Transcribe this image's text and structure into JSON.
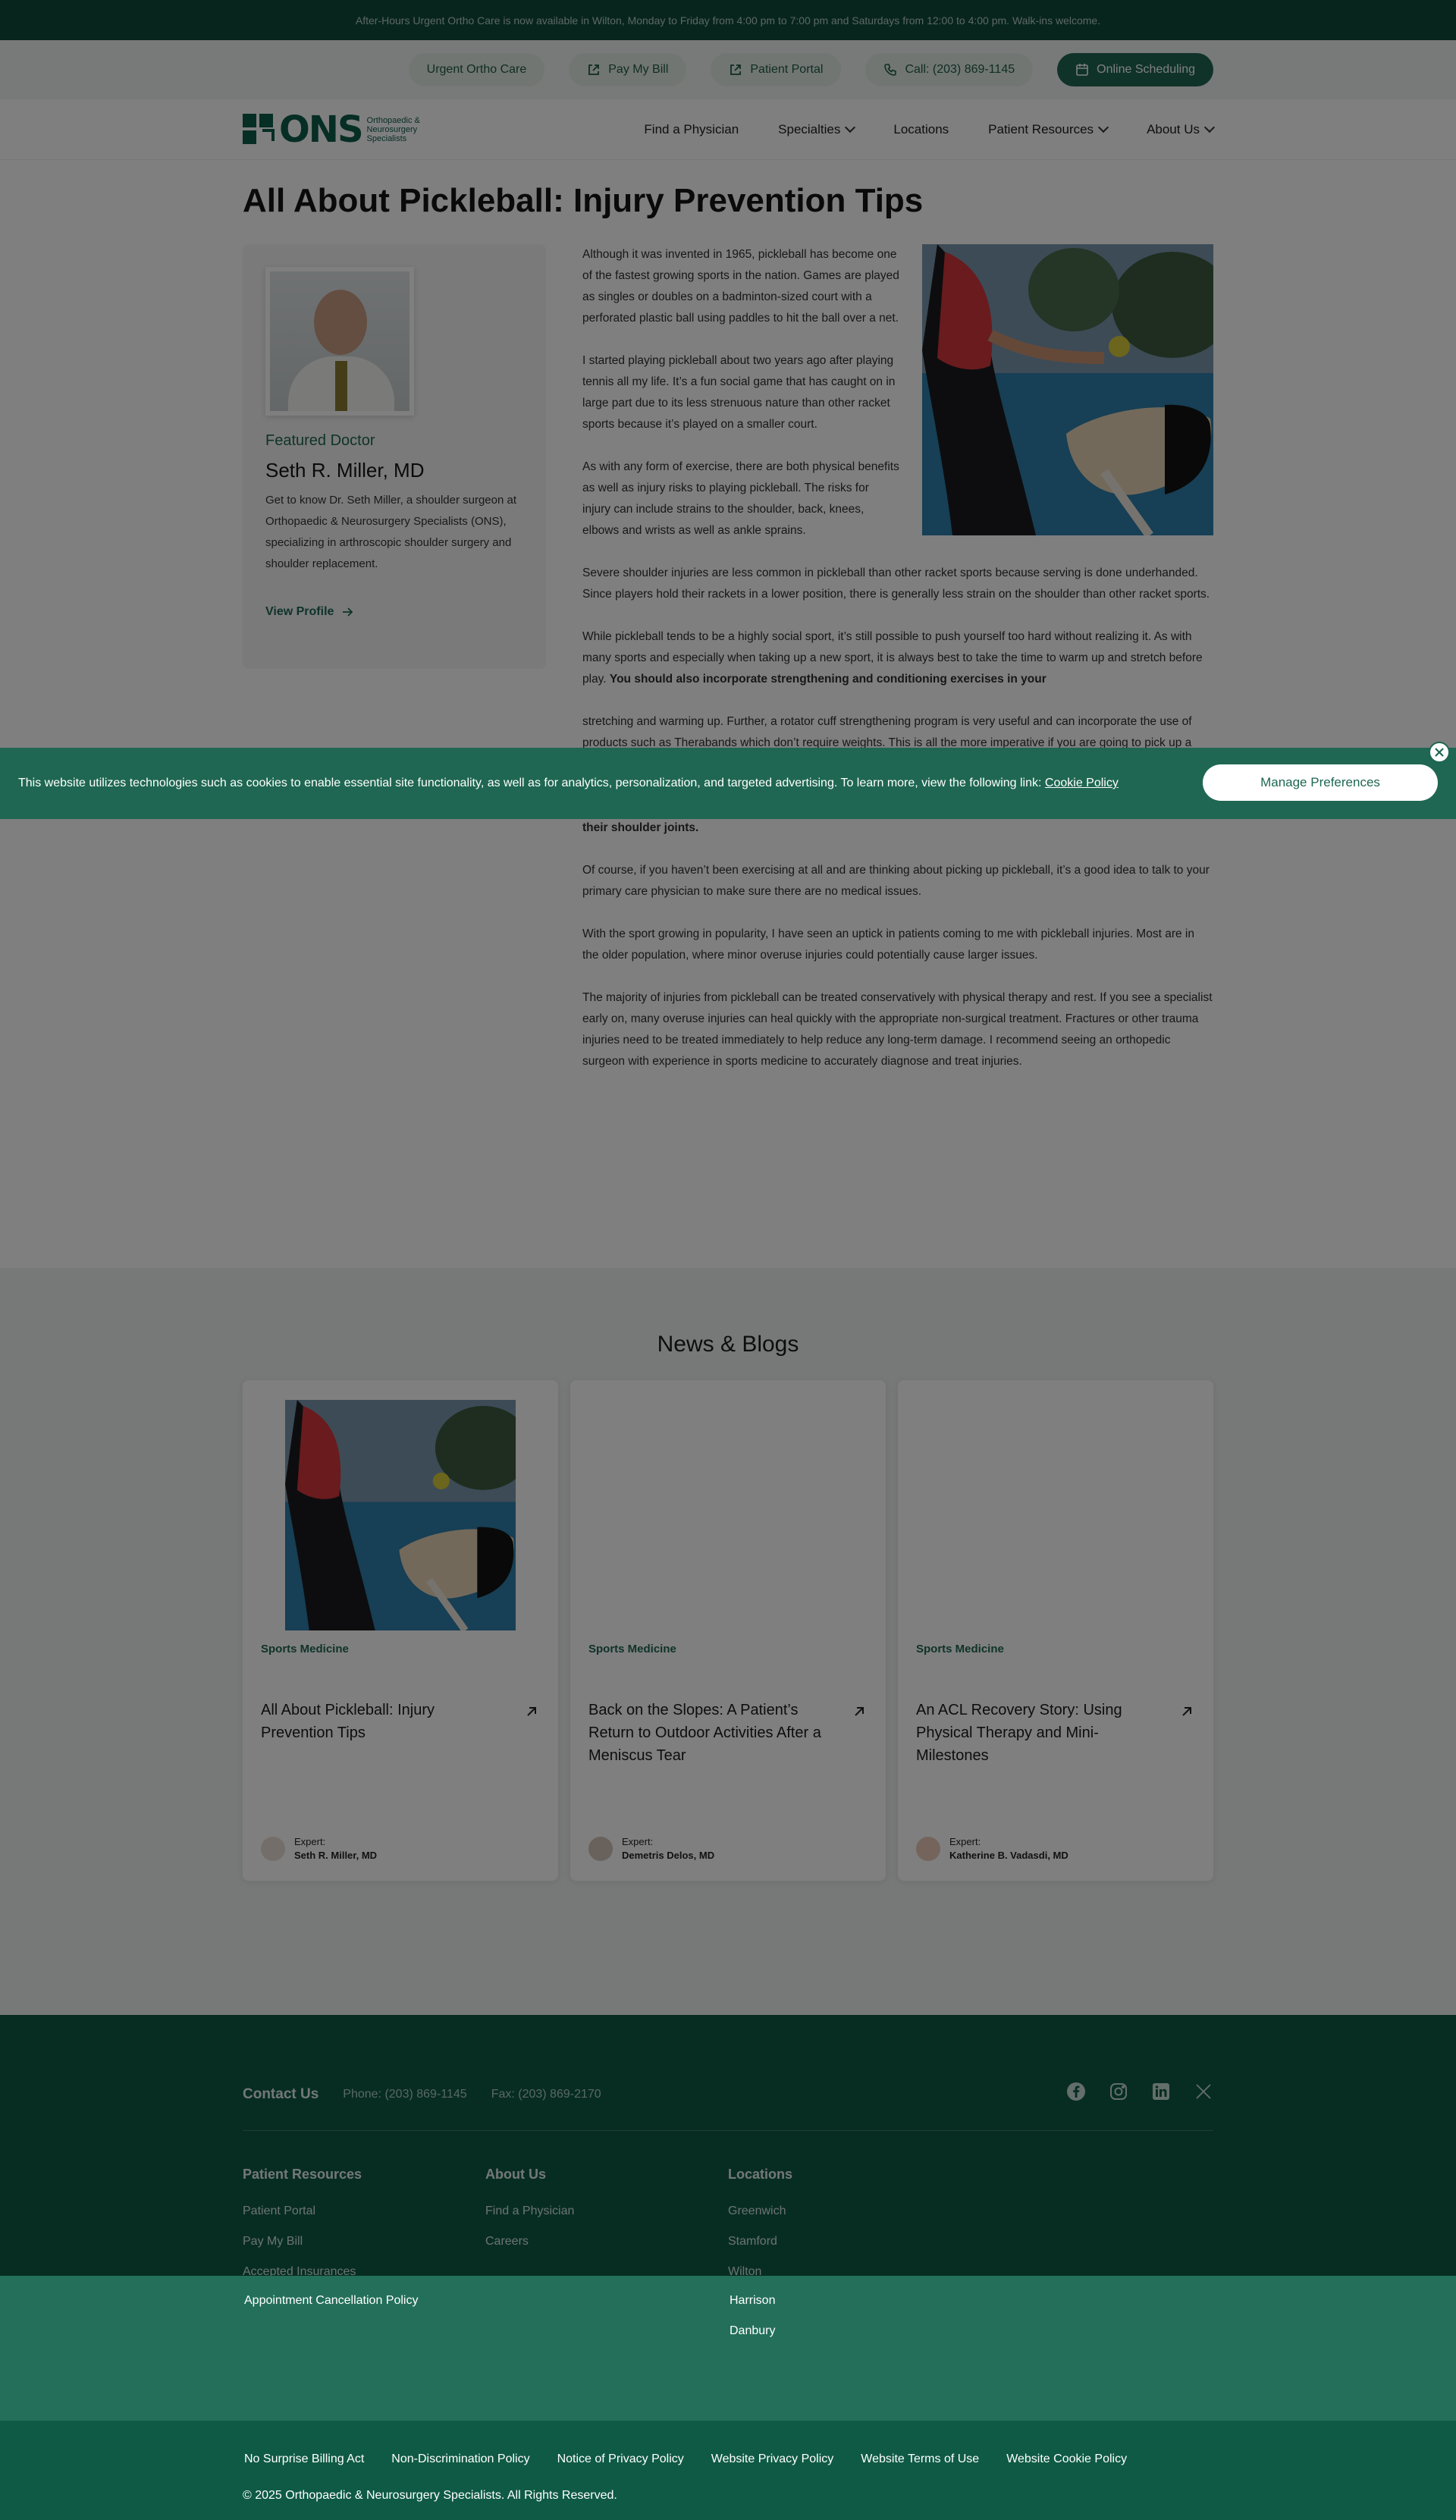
{
  "announcement": "After-Hours Urgent Ortho Care is now available in Wilton, Monday to Friday from 4:00 pm to 7:00 pm and Saturdays from 12:00 to 4:00 pm. Walk-ins welcome.",
  "utility": {
    "urgent": "Urgent Ortho Care",
    "pay": "Pay My Bill",
    "portal": "Patient Portal",
    "call": "Call: (203) 869-1145",
    "schedule": "Online Scheduling"
  },
  "logo": {
    "mark": "ONS",
    "sub": "Orthopaedic & Neurosurgery Specialists"
  },
  "nav": {
    "find": "Find a Physician",
    "specialties": "Specialties",
    "locations": "Locations",
    "resources": "Patient Resources",
    "about": "About Us"
  },
  "article": {
    "title": "All About Pickleball: Injury Prevention Tips",
    "p1": "Although it was invented in 1965, pickleball has become one of the fastest growing sports in the nation. Games are played as singles or doubles on a badminton-sized court with a perforated plastic ball using paddles to hit the ball over a net.",
    "p2": "I started playing pickleball about two years ago after playing tennis all my life. It’s a fun social game that has caught on in large part due to its less strenuous nature than other racket sports because it’s played on a smaller court.",
    "p3": "As with any form of exercise, there are both physical benefits as well as injury risks to playing pickleball. The risks for injury can include strains to the shoulder, back, knees, elbows and wrists as well as ankle sprains.",
    "p4": "Severe shoulder injuries are less common in pickleball than other racket sports because serving is done underhanded. Since players hold their rackets in a lower position, there is generally less strain on the shoulder than other racket sports.",
    "p5a": "While pickleball tends to be a highly social sport, it’s still possible to push yourself too hard without realizing it. As with many sports and especially when taking up a new sport, it is always best to take the time to warm up and stretch before play. ",
    "p5b": "You should also incorporate strengthening and conditioning exercises in your",
    "p5c": "stretching and warming up. Further, a rotator cuff strengthening program is very useful and can incorporate the use of products such as Therabands which don’t require weights. This is all the more imperative if you are going to pick up a new sport.",
    "p6": "Maintaining rotator cuff strength and overall shoulder flexibility is the best way someone can avoid injury to their shoulder joints.",
    "p7": "Of course, if you haven’t been exercising at all and are thinking about picking up pickleball, it’s a good idea to talk to your primary care physician to make sure there are no medical issues.",
    "p8": "With the sport growing in popularity, I have seen an uptick in patients coming to me with pickleball injuries. Most are in the older population, where minor overuse injuries could potentially cause larger issues.",
    "p9": "The majority of injuries from pickleball can be treated conservatively with physical therapy and rest. If you see a specialist early on, many overuse injuries can heal quickly with the appropriate non-surgical treatment. Fractures or other trauma injuries need to be treated immediately to help reduce any long-term damage. I recommend seeing an orthopedic surgeon with experience in sports medicine to accurately diagnose and treat injuries."
  },
  "doctor": {
    "featured": "Featured Doctor",
    "name": "Seth R. Miller, MD",
    "bio": "Get to know Dr. Seth Miller, a shoulder surgeon at Orthopaedic & Neurosurgery Specialists (ONS), specializing in arthroscopic shoulder surgery and shoulder replacement.",
    "view": "View Profile"
  },
  "cookie": {
    "message": "This website utilizes technologies such as cookies to enable essential site functionality, as well as for analytics, personalization, and targeted advertising. To learn more, view the following link: ",
    "link": "Cookie Policy",
    "button": "Manage Preferences"
  },
  "news": {
    "heading": "News & Blogs",
    "cards": [
      {
        "category": "Sports Medicine",
        "title": "All About Pickleball: Injury Prevention Tips",
        "expert_label": "Expert:",
        "expert": "Seth R. Miller, MD"
      },
      {
        "category": "Sports Medicine",
        "title": "Back on the Slopes: A Patient’s Return to Outdoor Activities After a Meniscus Tear",
        "expert_label": "Expert:",
        "expert": "Demetris Delos, MD"
      },
      {
        "category": "Sports Medicine",
        "title": "An ACL Recovery Story: Using Physical Therapy and Mini-Milestones",
        "expert_label": "Expert:",
        "expert": "Katherine B. Vadasdi, MD"
      }
    ]
  },
  "footer": {
    "contact_label": "Contact Us",
    "phone": "Phone: (203) 869-1145",
    "fax": "Fax: (203) 869-2170",
    "col1": {
      "heading": "Patient Resources",
      "links": [
        "Patient Portal",
        "Pay My Bill",
        "Accepted Insurances",
        "Appointment Cancellation Policy"
      ]
    },
    "col2": {
      "heading": "About Us",
      "links": [
        "Find a Physician",
        "Careers"
      ]
    },
    "col3": {
      "heading": "Locations",
      "links": [
        "Greenwich",
        "Stamford",
        "Wilton",
        "Harrison",
        "Danbury"
      ]
    },
    "legal": [
      "No Surprise Billing Act",
      "Non-Discrimination Policy",
      "Notice of Privacy Policy",
      "Website Privacy Policy",
      "Website Terms of Use",
      "Website Cookie Policy"
    ],
    "copyright": "© 2025 Orthopaedic & Neurosurgery Specialists. All Rights Reserved."
  },
  "colors": {
    "brand": "#1f6752",
    "footer": "#0f5a45",
    "cookie": "#1f6752"
  }
}
